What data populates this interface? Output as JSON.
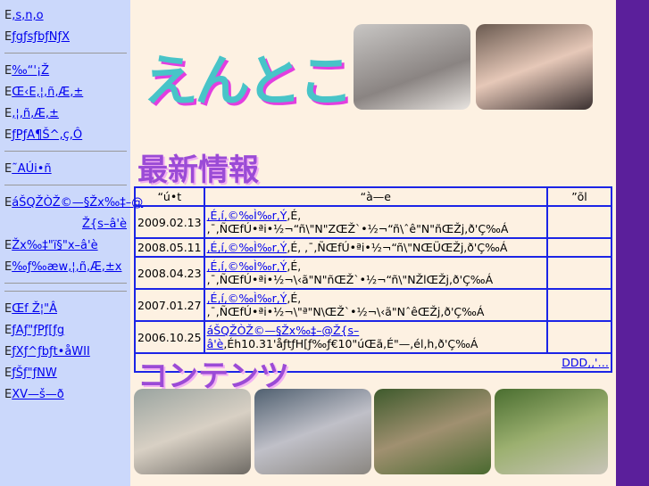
{
  "sidebar": {
    "groups": [
      [
        {
          "p": "E",
          "l": ",s,n,o"
        },
        {
          "p": "E",
          "l": "ƒgƒsƒbƒNƒX"
        }
      ],
      [
        {
          "p": "E",
          "l": "‰“'¡Ž"
        },
        {
          "p": "E",
          "l": "Œ‹E,¦,ñ,Æ,±"
        },
        {
          "p": "E",
          "l": ",¦,ñ,Æ,±"
        },
        {
          "p": "E",
          "l": "ƒPƒA¶Š^,ç,Ô"
        }
      ],
      [
        {
          "p": "E",
          "l": "˜AÚi•ñ"
        }
      ],
      [
        {
          "p": "E",
          "l": "áŠQŽÒŽ©—§Žx‰‡–@"
        },
        {
          "p": "",
          "l": "Ž{s–â'è"
        },
        {
          "p": "E",
          "l": "Žx‰‡\"ï§\"x–â'è"
        },
        {
          "p": "E",
          "l": "‰ƒ‰æw,¦,ñ,Æ,±x"
        }
      ],
      [],
      [
        {
          "p": "E",
          "l": "Œf Ž¦\"Â"
        },
        {
          "p": "E",
          "l": "ƒAƒ\"ƒPƒ[ƒg"
        },
        {
          "p": "E",
          "l": "ƒXƒ^ƒbƒt•åWII"
        },
        {
          "p": "E",
          "l": "ƒŠƒ\"ƒNW"
        },
        {
          "p": "E",
          "l": "XV—š—ð"
        }
      ]
    ]
  },
  "header": {
    "logo": "えんとこ"
  },
  "news": {
    "heading": "最新情報",
    "cols": [
      "“ú•t",
      "“à—e",
      "”õl"
    ],
    "rows": [
      {
        "date": "2009.02.13",
        "link": ",É,í,©‰Ì‰r,Ý",
        "text": ",É, ,¯,ÑŒfÚ•ªi•½¬“ñ\\\"N\"ZŒŽ`•½¬“ñ\\ˆê\"N\"ñŒŽj,ð'Ç‰Á"
      },
      {
        "date": "2008.05.11",
        "link": ",É,í,©‰Ì‰r,Ý",
        "text": ",É, ,¯,ÑŒfÚ•ªi•½¬“ñ\\\"NŒÜŒŽj,ð'Ç‰Á"
      },
      {
        "date": "2008.04.23",
        "link": ",É,í,©‰Ì‰r,Ý",
        "text": ",É, ,¯,ÑŒfÚ•ªi•½¬\\‹ã\"N\"ñŒŽ`•½¬“ñ\\\"NŽlŒŽj,ð'Ç‰Á"
      },
      {
        "date": "2007.01.27",
        "link": ",É,í,©‰Ì‰r,Ý",
        "text": ",É, ,¯,ÑŒfÚ•ªi•½¬\\\"ª\"N\\ŒŽ`•½¬\\‹ã\"NˆêŒŽj,ð'Ç‰Á"
      },
      {
        "date": "2006.10.25",
        "link": "áŠQŽÒŽ©—§Žx‰‡–@Ž{s–â'è",
        "text": ",Éh10.31'åƒtƒH[ƒ‰ƒ€10\"úŒã,É\"—,él‚h,ð'Ç‰Á"
      }
    ],
    "more": "DDD‚‚'…"
  },
  "contents": {
    "heading": "コンテンツ"
  }
}
